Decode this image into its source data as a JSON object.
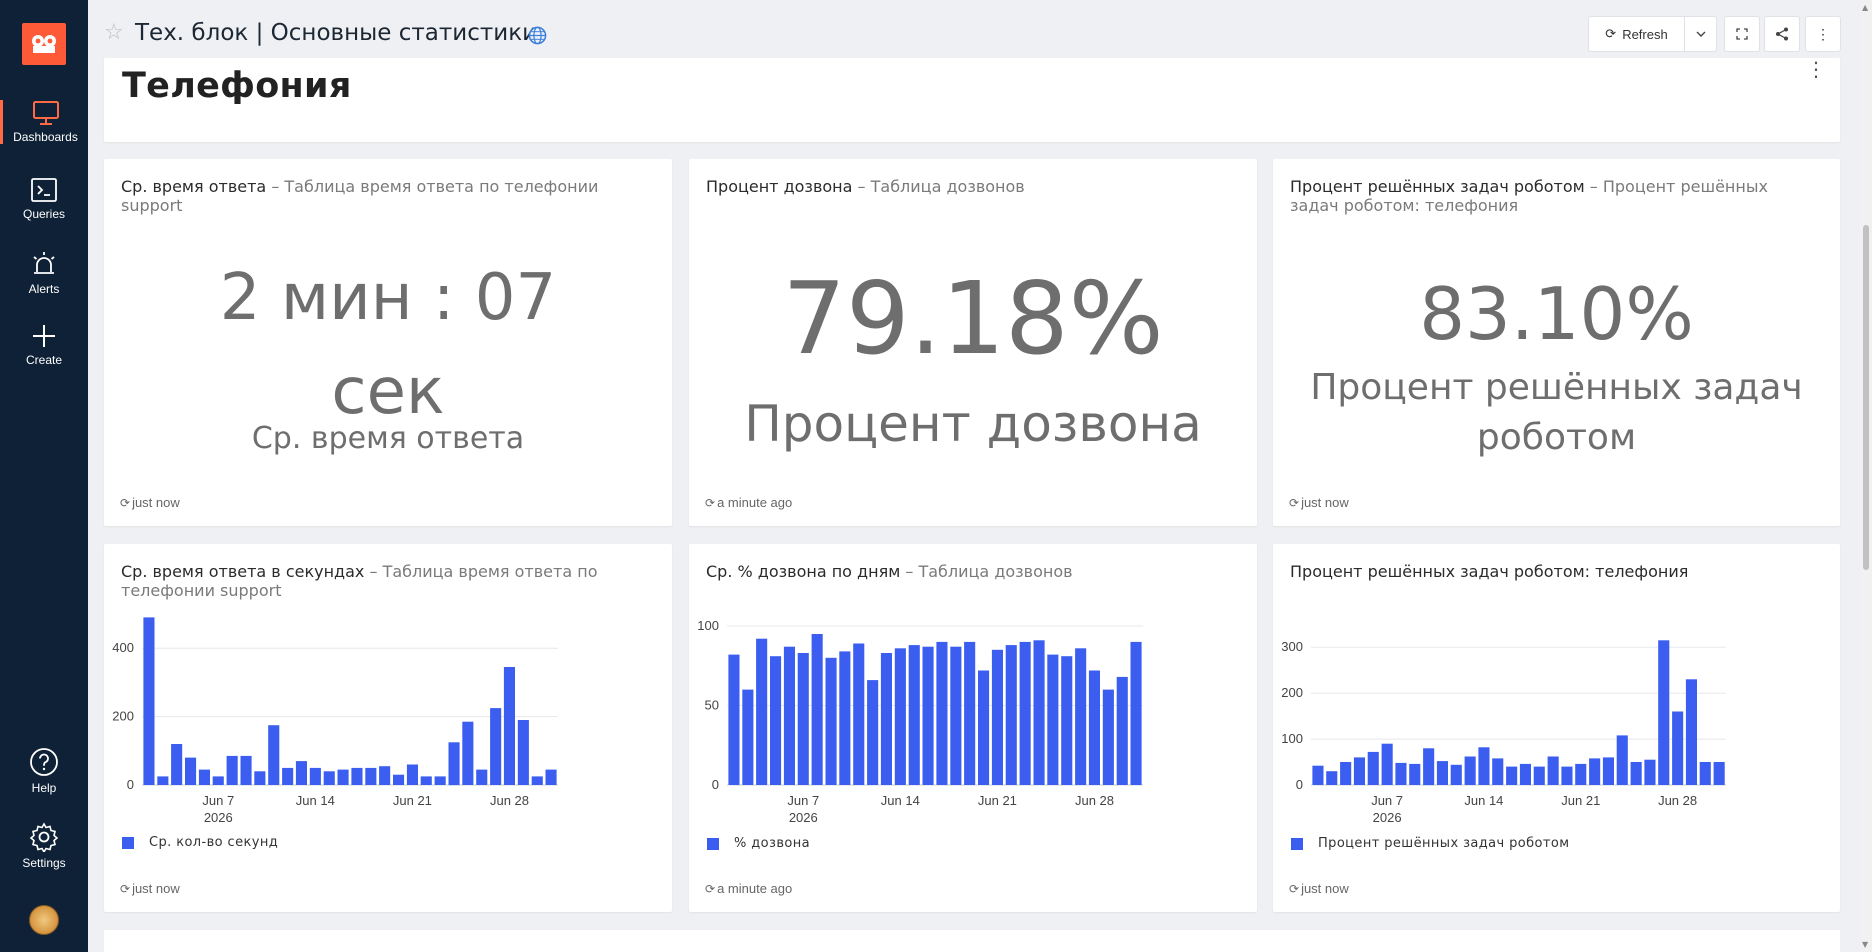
{
  "app": {
    "logo_text": "RD"
  },
  "sidebar": {
    "items": [
      {
        "label": "Dashboards",
        "icon": "monitor-icon",
        "active": true
      },
      {
        "label": "Queries",
        "icon": "terminal-icon"
      },
      {
        "label": "Alerts",
        "icon": "alarm-icon"
      },
      {
        "label": "Create",
        "icon": "plus-icon"
      },
      {
        "label": "Help",
        "icon": "help-circle-icon"
      },
      {
        "label": "Settings",
        "icon": "gear-icon"
      }
    ]
  },
  "header": {
    "title": "Тех. блок | Основные статистики",
    "refresh_label": "Refresh"
  },
  "text_widget": {
    "heading": "Телефония"
  },
  "widgets": {
    "avg_answer_time": {
      "title": "Ср. время ответа",
      "subtitle": "Таблица время ответа по телефонии support",
      "value_line1": "2 мин : 07",
      "value_line2": "сек",
      "label": "Ср. время ответа",
      "updated": "just now"
    },
    "call_rate": {
      "title": "Процент дозвона",
      "subtitle": "Таблица дозвонов",
      "value": "79.18%",
      "label": "Процент дозвона",
      "updated": "a minute ago"
    },
    "robot_rate": {
      "title": "Процент решённых задач роботом",
      "subtitle": "Процент решённых задач роботом: телефония",
      "value": "83.10%",
      "label_line1": "Процент решённых задач",
      "label_line2": "роботом",
      "updated": "just now"
    },
    "avg_seconds_chart": {
      "title": "Ср. время ответа в секундах",
      "subtitle": "Таблица время ответа по телефонии support",
      "legend": "Ср. кол-во секунд",
      "updated": "just now"
    },
    "daily_call_rate_chart": {
      "title": "Ср. % дозвона по дням",
      "subtitle": "Таблица дозвонов",
      "legend": "% дозвона",
      "updated": "a minute ago"
    },
    "robot_phone_chart": {
      "title": "Процент решённых задач роботом: телефония",
      "subtitle": "",
      "legend": "Процент решённых задач роботом",
      "updated": "just now"
    }
  },
  "chart_data": [
    {
      "type": "bar",
      "series": [
        {
          "name": "Ср. кол-во секунд",
          "values": [
            490,
            25,
            120,
            80,
            45,
            25,
            85,
            85,
            40,
            175,
            50,
            70,
            50,
            40,
            45,
            50,
            50,
            55,
            30,
            60,
            25,
            25,
            125,
            185,
            45,
            225,
            345,
            190,
            25,
            45
          ]
        }
      ],
      "x_tick_labels": [
        "Jun 7",
        "Jun 14",
        "Jun 21",
        "Jun 28"
      ],
      "x_sublabel": "2026",
      "y_ticks": [
        0,
        200,
        400
      ],
      "ylim": [
        0,
        500
      ],
      "color": "#3b5ef0"
    },
    {
      "type": "bar",
      "series": [
        {
          "name": "% дозвона",
          "values": [
            82,
            60,
            92,
            81,
            87,
            83,
            95,
            80,
            84,
            89,
            66,
            83,
            86,
            88,
            87,
            90,
            87,
            90,
            72,
            85,
            88,
            90,
            91,
            82,
            81,
            86,
            72,
            60,
            68,
            90
          ]
        }
      ],
      "x_tick_labels": [
        "Jun 7",
        "Jun 14",
        "Jun 21",
        "Jun 28"
      ],
      "x_sublabel": "2026",
      "y_ticks": [
        0,
        50,
        100
      ],
      "ylim": [
        0,
        100
      ],
      "color": "#3b5ef0"
    },
    {
      "type": "bar",
      "series": [
        {
          "name": "Процент решённых задач роботом",
          "values": [
            42,
            30,
            50,
            60,
            72,
            90,
            48,
            46,
            80,
            52,
            44,
            62,
            82,
            58,
            40,
            46,
            40,
            62,
            40,
            46,
            58,
            60,
            108,
            50,
            55,
            315,
            160,
            230,
            50,
            50
          ]
        }
      ],
      "x_tick_labels": [
        "Jun 7",
        "Jun 14",
        "Jun 21",
        "Jun 28"
      ],
      "x_sublabel": "2026",
      "y_ticks": [
        0,
        100,
        200,
        300
      ],
      "ylim": [
        0,
        320
      ],
      "color": "#3b5ef0"
    }
  ]
}
